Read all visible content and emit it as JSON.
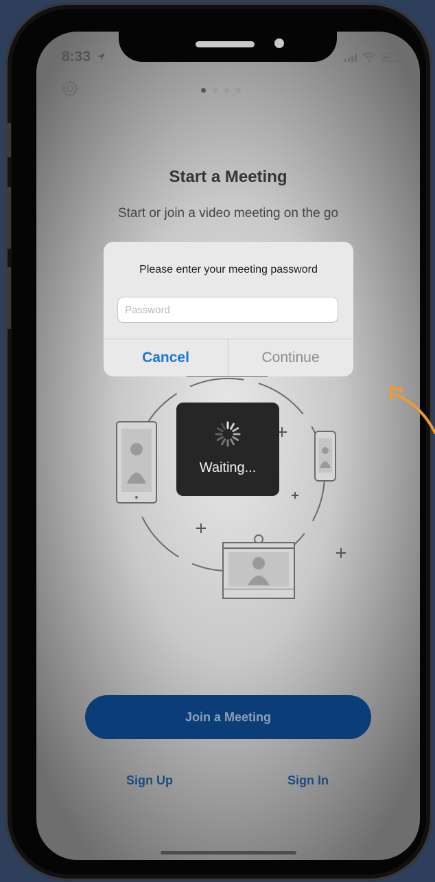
{
  "status_bar": {
    "time": "8:33",
    "location_icon": "location-arrow-icon"
  },
  "page": {
    "title": "Start a Meeting",
    "subtitle": "Start or join a video meeting on the go",
    "page_indicator": {
      "count": 4,
      "active": 1
    }
  },
  "dialog": {
    "message": "Please enter your meeting password",
    "password_placeholder": "Password",
    "password_value": "",
    "cancel_label": "Cancel",
    "continue_label": "Continue"
  },
  "loading": {
    "text": "Waiting..."
  },
  "actions": {
    "join_label": "Join a Meeting",
    "signup_label": "Sign Up",
    "signin_label": "Sign In"
  },
  "colors": {
    "background": "#2e3f5c",
    "accent_blue": "#1a76d2",
    "join_button": "#0b3d78",
    "annotation_arrow": "#f29a2e"
  }
}
